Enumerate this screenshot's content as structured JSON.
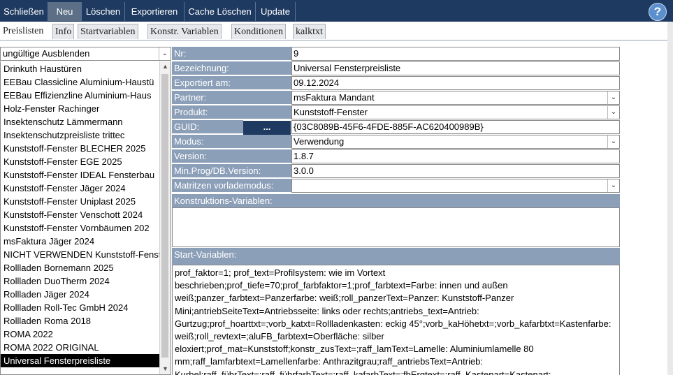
{
  "toolbar": {
    "buttons": [
      {
        "label": "Schließen",
        "active": false
      },
      {
        "label": "Neu",
        "active": true
      },
      {
        "label": "Löschen",
        "active": false
      },
      {
        "label": "Exportieren",
        "active": false
      },
      {
        "label": "Cache Löschen",
        "active": false
      },
      {
        "label": "Update",
        "active": false
      }
    ],
    "help_label": "?"
  },
  "tabs": [
    {
      "label": "Preislisten",
      "active": true
    },
    {
      "label": "Info",
      "active": false
    },
    {
      "label": "Startvariablen",
      "active": false
    },
    {
      "label": "Konstr. Variablen",
      "active": false
    },
    {
      "label": "Konditionen",
      "active": false
    },
    {
      "label": "kalktxt",
      "active": false
    }
  ],
  "filter": {
    "value": "ungültige Ausblenden"
  },
  "list": {
    "items": [
      "Drinkuth Haustüren",
      "EEBau Classicline Aluminium-Haustü",
      "EEBau Effizienzline Aluminium-Haus",
      "Holz-Fenster Rachinger",
      "Insektenschutz Lämmermann",
      "Insektenschutzpreisliste trittec",
      "Kunststoff-Fenster BLECHER 2025",
      "Kunststoff-Fenster EGE 2025",
      "Kunststoff-Fenster IDEAL Fensterbau",
      "Kunststoff-Fenster Jäger 2024",
      "Kunststoff-Fenster Uniplast 2025",
      "Kunststoff-Fenster Venschott 2024",
      "Kunststoff-Fenster Vornbäumen 202",
      "msFaktura Jäger 2024",
      "NICHT VERWENDEN Kunststoff-Fenst",
      "Rollladen Bornemann 2025",
      "Rollladen DuoTherm 2024",
      "Rollladen Jäger 2024",
      "Rollladen Roll-Tec GmbH 2024",
      "Rollladen Roma 2018",
      "ROMA 2022",
      "ROMA 2022 ORIGINAL",
      "Universal Fensterpreisliste"
    ],
    "selected_index": 22
  },
  "form": {
    "nr": {
      "label": "Nr:",
      "value": "9"
    },
    "bezeichnung": {
      "label": "Bezeichnung:",
      "value": "Universal Fensterpreisliste"
    },
    "exportiert": {
      "label": "Exportiert am:",
      "value": "09.12.2024"
    },
    "partner": {
      "label": "Partner:",
      "value": "msFaktura Mandant"
    },
    "produkt": {
      "label": "Produkt:",
      "value": "Kunststoff-Fenster"
    },
    "guid": {
      "label": "GUID:",
      "button": "...",
      "value": "{03C8089B-45F6-4FDE-885F-AC620400989B}"
    },
    "modus": {
      "label": "Modus:",
      "value": "Verwendung"
    },
    "version": {
      "label": "Version:",
      "value": "1.8.7"
    },
    "min_prog": {
      "label": "Min.Prog/DB.Version:",
      "value": "3.0.0"
    },
    "matrizen": {
      "label": "Matritzen vorlademodus:",
      "value": ""
    },
    "konstruktions_label": "Konstruktions-Variablen:",
    "start_label": "Start-Variablen:",
    "start_text": "prof_faktor=1; prof_text=Profilsystem: wie im Vortext beschrieben;prof_tiefe=70;prof_farbfaktor=1;prof_farbtext=Farbe: innen und außen weiß;panzer_farbtext=Panzerfarbe: weiß;roll_panzerText=Panzer: Kunststoff-Panzer Mini;antriebSeiteText=Antriebsseite: links oder rechts;antriebs_text=Antrieb: Gurtzug;prof_hoarttxt=;vorb_katxt=Rollladenkasten: eckig 45°;vorb_kaHöhetxt=;vorb_kafarbtxt=Kastenfarbe: weiß;roll_revtext=;aluFB_farbtext=Oberfläche: silber eloxiert;prof_mat=Kunststoff;konstr_zusText=;raff_lamText=Lamelle: Aluminiumlamelle 80 mm;raff_lamfarbtext=Lamellenfarbe: Anthrazitgrau;raff_antriebsText=Antrieb: Kurbel;raff_führText=;raff_führfarbText=;raff_kafarbText=;fbErgtext=;raff_Kastenart=Kastenart:"
  }
}
